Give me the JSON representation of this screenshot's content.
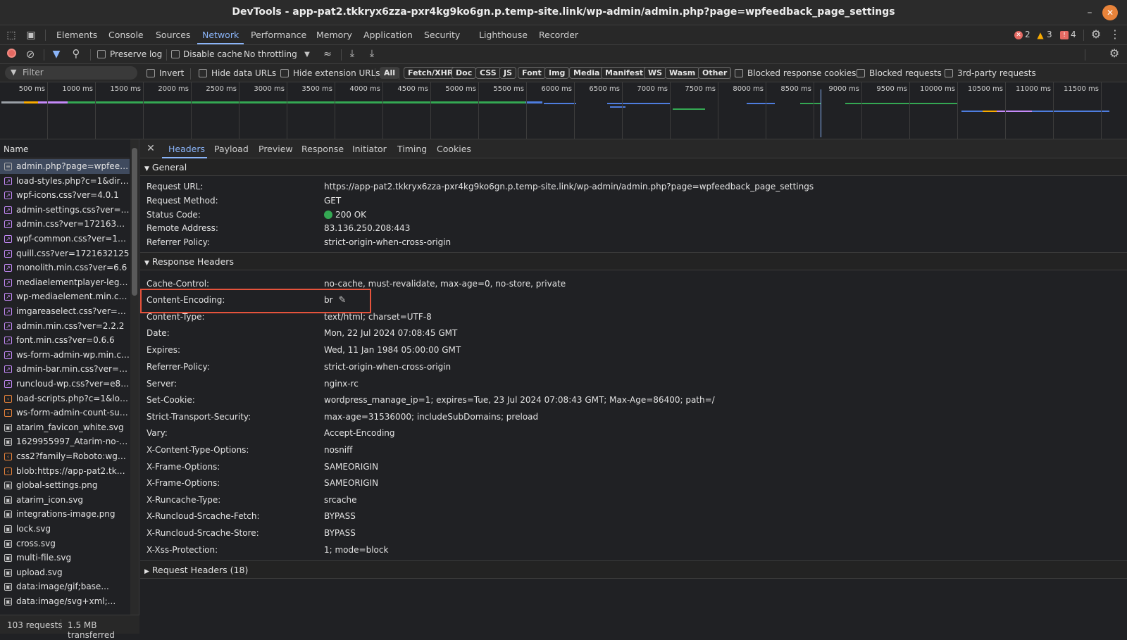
{
  "window": {
    "title": "DevTools - app-pat2.tkkryx6zza-pxr4kg9ko6gn.p.temp-site.link/wp-admin/admin.php?page=wpfeedback_page_settings"
  },
  "main_tabs": [
    {
      "label": "Elements"
    },
    {
      "label": "Console"
    },
    {
      "label": "Sources"
    },
    {
      "label": "Network"
    },
    {
      "label": "Performance"
    },
    {
      "label": "Memory"
    },
    {
      "label": "Application"
    },
    {
      "label": "Security"
    },
    {
      "label": "Lighthouse"
    },
    {
      "label": "Recorder"
    }
  ],
  "issues": {
    "errors": "2",
    "warnings": "3",
    "messages": "4"
  },
  "toolbar": {
    "preserve_log": "Preserve log",
    "disable_cache": "Disable cache",
    "throttling": "No throttling"
  },
  "filterbar": {
    "placeholder": "Filter",
    "invert": "Invert",
    "hide_data_urls": "Hide data URLs",
    "hide_ext_urls": "Hide extension URLs",
    "types": [
      "All",
      "Fetch/XHR",
      "Doc",
      "CSS",
      "JS",
      "Font",
      "Img",
      "Media",
      "Manifest",
      "WS",
      "Wasm",
      "Other"
    ],
    "blocked_cookies": "Blocked response cookies",
    "blocked_requests": "Blocked requests",
    "third_party": "3rd-party requests"
  },
  "overview": {
    "ticks": [
      "500 ms",
      "1000 ms",
      "1500 ms",
      "2000 ms",
      "2500 ms",
      "3000 ms",
      "3500 ms",
      "4000 ms",
      "4500 ms",
      "5000 ms",
      "5500 ms",
      "6000 ms",
      "6500 ms",
      "7000 ms",
      "7500 ms",
      "8000 ms",
      "8500 ms",
      "9000 ms",
      "9500 ms",
      "10000 ms",
      "10500 ms",
      "11000 ms",
      "11500 ms"
    ]
  },
  "requests": {
    "header": "Name",
    "items": [
      {
        "name": "admin.php?page=wpfeedba...",
        "icon": "doc"
      },
      {
        "name": "load-styles.php?c=1&dir=ltr...",
        "icon": "css"
      },
      {
        "name": "wpf-icons.css?ver=4.0.1",
        "icon": "css"
      },
      {
        "name": "admin-settings.css?ver=172...",
        "icon": "css"
      },
      {
        "name": "admin.css?ver=1721632125",
        "icon": "css"
      },
      {
        "name": "wpf-common.css?ver=17216...",
        "icon": "css"
      },
      {
        "name": "quill.css?ver=1721632125",
        "icon": "css"
      },
      {
        "name": "monolith.min.css?ver=6.6",
        "icon": "css"
      },
      {
        "name": "mediaelementplayer-legac...",
        "icon": "css"
      },
      {
        "name": "wp-mediaelement.min.css?...",
        "icon": "css"
      },
      {
        "name": "imgareaselect.css?ver=0.9.8",
        "icon": "css"
      },
      {
        "name": "admin.min.css?ver=2.2.2",
        "icon": "css"
      },
      {
        "name": "font.min.css?ver=0.6.6",
        "icon": "css"
      },
      {
        "name": "ws-form-admin-wp.min.css...",
        "icon": "css"
      },
      {
        "name": "admin-bar.min.css?ver=2.2.2",
        "icon": "css"
      },
      {
        "name": "runcloud-wp.css?ver=e8a27...",
        "icon": "css"
      },
      {
        "name": "load-scripts.php?c=1&load...",
        "icon": "js"
      },
      {
        "name": "ws-form-admin-count-sub...",
        "icon": "js"
      },
      {
        "name": "atarim_favicon_white.svg",
        "icon": "img"
      },
      {
        "name": "1629955997_Atarim-no-pad...",
        "icon": "img"
      },
      {
        "name": "css2?family=Roboto:wght@...",
        "icon": "js"
      },
      {
        "name": "blob:https://app-pat2.tkkry...",
        "icon": "js"
      },
      {
        "name": "global-settings.png",
        "icon": "img"
      },
      {
        "name": "atarim_icon.svg",
        "icon": "img"
      },
      {
        "name": "integrations-image.png",
        "icon": "img"
      },
      {
        "name": "lock.svg",
        "icon": "img"
      },
      {
        "name": "cross.svg",
        "icon": "img"
      },
      {
        "name": "multi-file.svg",
        "icon": "img"
      },
      {
        "name": "upload.svg",
        "icon": "img"
      },
      {
        "name": "data:image/gif;base...",
        "icon": "img"
      },
      {
        "name": "data:image/svg+xml;...",
        "icon": "img"
      }
    ]
  },
  "status": {
    "requests": "103 requests",
    "transferred": "1.5 MB transferred"
  },
  "detail_tabs": [
    "Headers",
    "Payload",
    "Preview",
    "Response",
    "Initiator",
    "Timing",
    "Cookies"
  ],
  "general": {
    "title": "General",
    "rows": [
      {
        "key": "Request URL:",
        "value": "https://app-pat2.tkkryx6zza-pxr4kg9ko6gn.p.temp-site.link/wp-admin/admin.php?page=wpfeedback_page_settings"
      },
      {
        "key": "Request Method:",
        "value": "GET"
      },
      {
        "key": "Status Code:",
        "value": "200 OK"
      },
      {
        "key": "Remote Address:",
        "value": "83.136.250.208:443"
      },
      {
        "key": "Referrer Policy:",
        "value": "strict-origin-when-cross-origin"
      }
    ]
  },
  "response_headers": {
    "title": "Response Headers",
    "rows": [
      {
        "key": "Cache-Control:",
        "value": "no-cache, must-revalidate, max-age=0, no-store, private"
      },
      {
        "key": "Content-Encoding:",
        "value": "br"
      },
      {
        "key": "Content-Type:",
        "value": "text/html; charset=UTF-8"
      },
      {
        "key": "Date:",
        "value": "Mon, 22 Jul 2024 07:08:45 GMT"
      },
      {
        "key": "Expires:",
        "value": "Wed, 11 Jan 1984 05:00:00 GMT"
      },
      {
        "key": "Referrer-Policy:",
        "value": "strict-origin-when-cross-origin"
      },
      {
        "key": "Server:",
        "value": "nginx-rc"
      },
      {
        "key": "Set-Cookie:",
        "value": "wordpress_manage_ip=1; expires=Tue, 23 Jul 2024 07:08:43 GMT; Max-Age=86400; path=/"
      },
      {
        "key": "Strict-Transport-Security:",
        "value": "max-age=31536000; includeSubDomains; preload"
      },
      {
        "key": "Vary:",
        "value": "Accept-Encoding"
      },
      {
        "key": "X-Content-Type-Options:",
        "value": "nosniff"
      },
      {
        "key": "X-Frame-Options:",
        "value": "SAMEORIGIN"
      },
      {
        "key": "X-Frame-Options:",
        "value": "SAMEORIGIN"
      },
      {
        "key": "X-Runcache-Type:",
        "value": "srcache"
      },
      {
        "key": "X-Runcloud-Srcache-Fetch:",
        "value": "BYPASS"
      },
      {
        "key": "X-Runcloud-Srcache-Store:",
        "value": "BYPASS"
      },
      {
        "key": "X-Xss-Protection:",
        "value": "1; mode=block"
      }
    ]
  },
  "request_headers": {
    "title": "Request Headers (18)"
  },
  "colors": {
    "accent": "#8ab4f8",
    "highlight": "#e5533c",
    "status_ok": "#34a853",
    "error": "#e46962",
    "warning": "#f9ab00"
  }
}
